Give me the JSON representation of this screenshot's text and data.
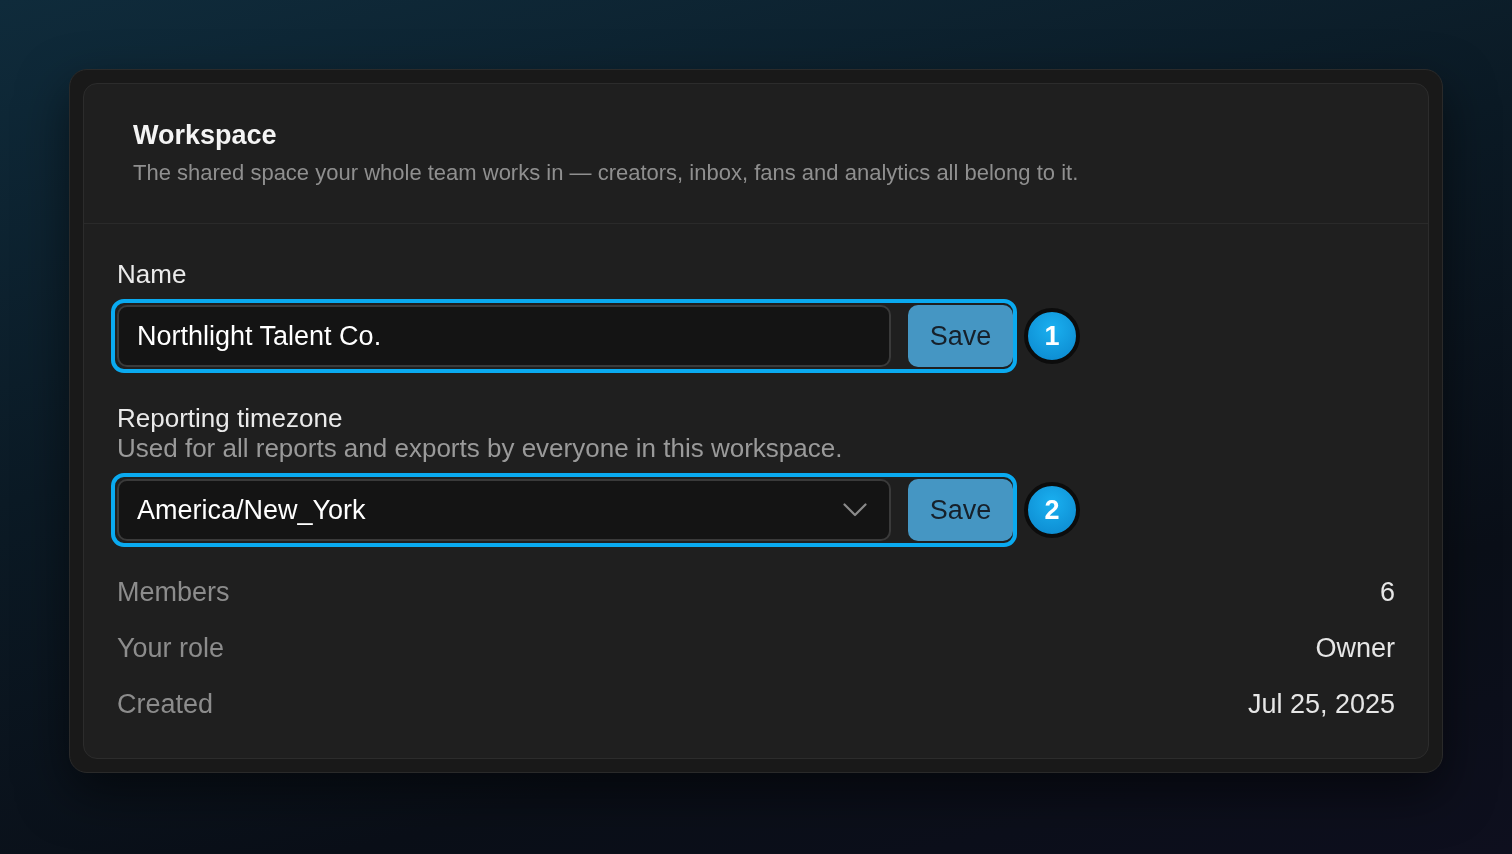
{
  "card": {
    "title": "Workspace",
    "description": "The shared space your whole team works in — creators, inbox, fans and analytics all belong to it."
  },
  "fields": [
    {
      "kind": "text",
      "label": "Name",
      "value": "Northlight Talent Co.",
      "button": "Save",
      "highlighted": true,
      "callout": "1"
    },
    {
      "kind": "select",
      "label": "Reporting timezone",
      "hint": "Used for all reports and exports by everyone in this workspace.",
      "value": "America/New_York",
      "button": "Save",
      "highlighted": true,
      "callout": "2"
    }
  ],
  "details": [
    {
      "label": "Members",
      "value": "6"
    },
    {
      "label": "Your role",
      "value": "Owner"
    },
    {
      "label": "Created",
      "value": "Jul 25, 2025"
    }
  ]
}
